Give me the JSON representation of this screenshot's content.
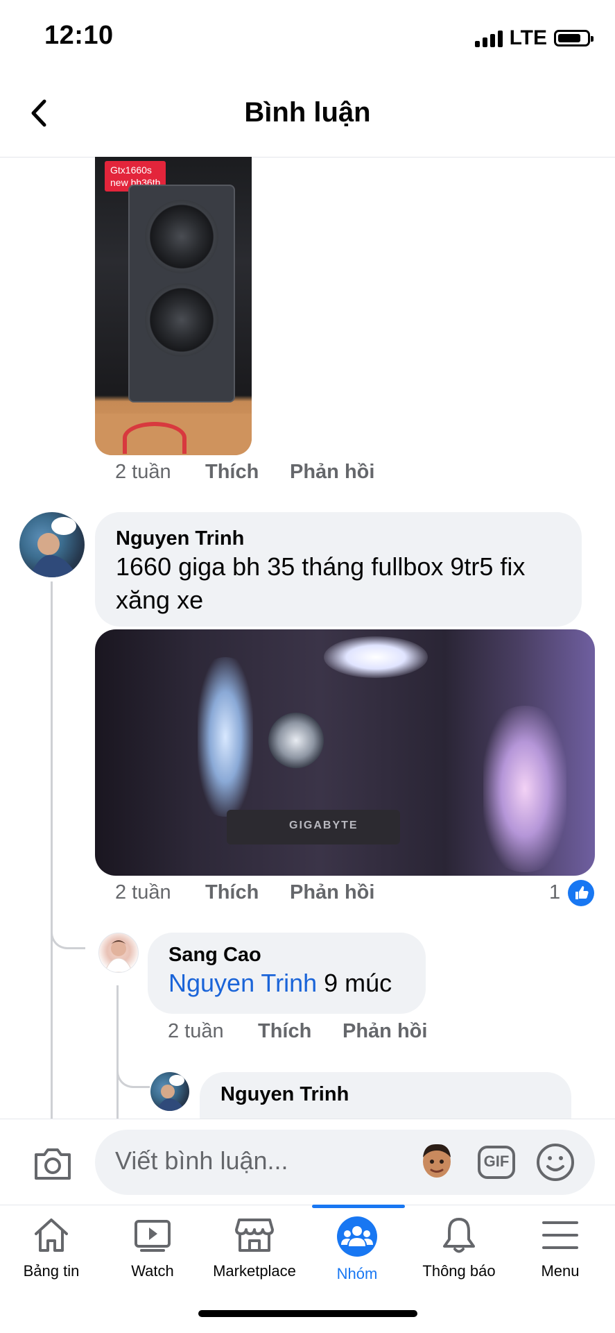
{
  "status_bar": {
    "time": "12:10",
    "network": "LTE"
  },
  "header": {
    "title": "Bình luận",
    "back_icon": "chevron-left-icon"
  },
  "comments": [
    {
      "image_label": "Gtx1660s\nnew bh36th",
      "meta": {
        "time": "2 tuần",
        "like": "Thích",
        "reply": "Phản hồi"
      }
    },
    {
      "author": "Nguyen Trinh",
      "text": "1660 giga bh 35 tháng fullbox 9tr5 fix xăng xe",
      "image_text": "GIGABYTE",
      "meta": {
        "time": "2 tuần",
        "like": "Thích",
        "reply": "Phản hồi"
      },
      "reaction_count": "1",
      "replies": [
        {
          "author": "Sang Cao",
          "mention": "Nguyen Trinh",
          "text": " 9 múc",
          "meta": {
            "time": "2 tuần",
            "like": "Thích",
            "reply": "Phản hồi"
          }
        },
        {
          "author": "Nguyen Trinh"
        }
      ]
    }
  ],
  "composer": {
    "placeholder": "Viết bình luận...",
    "icons": [
      "camera-icon",
      "avatar-sticker-icon",
      "gif-icon",
      "emoji-icon"
    ],
    "gif_label": "GIF"
  },
  "tabbar": {
    "items": [
      {
        "label": "Bảng tin",
        "icon": "home-icon"
      },
      {
        "label": "Watch",
        "icon": "watch-icon"
      },
      {
        "label": "Marketplace",
        "icon": "marketplace-icon"
      },
      {
        "label": "Nhóm",
        "icon": "groups-icon",
        "active": true
      },
      {
        "label": "Thông báo",
        "icon": "bell-icon"
      },
      {
        "label": "Menu",
        "icon": "menu-icon"
      }
    ]
  },
  "colors": {
    "accent": "#1877f2",
    "bubble": "#f0f2f5",
    "meta_text": "#65676b",
    "mention": "#1a64d8"
  }
}
